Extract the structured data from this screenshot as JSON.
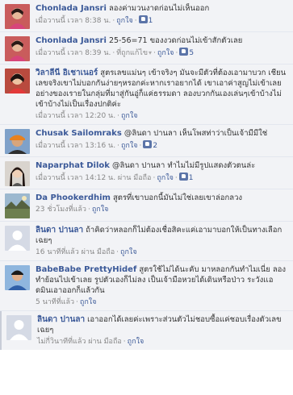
{
  "comments": [
    {
      "author": "Chonlada Jansri",
      "text": "ลองค่ามวนงาดก่อนไม่เห็นออก",
      "time": "เมื่อวานนี้ เวลา 8:38 น.",
      "like_label": "ถูกใจ",
      "likes": "1",
      "via": "",
      "avatar": "woman-pink-photo"
    },
    {
      "author": "Chonlada Jansri",
      "text": "25-56=71 ของงวดก่อนไม่เข้าสักตัวเลย",
      "time": "เมื่อวานนี้ เวลา 8:39 น.",
      "edited_label": "ที่ถูกแก้ไข",
      "like_label": "ถูกใจ",
      "likes": "5",
      "via": "",
      "avatar": "woman-pink-photo"
    },
    {
      "author": "วิลาลีนี อิเชาเนอร์",
      "text": "สูตรเลขแม่นๆ เข้าจริงๆ มันจะมีตัวที่ต้องเอามาบวก เชียนเลขจริงเขาไม่บอกกันง่ายๆหรอกค่ะหากเราอยากได้ เขาเอาค่าสูญไม่เข้าเลย อย่างของเรายในกลุ่มที่มาสู่กันอู่ก็แค่ธรรมดา ลองบวกกันเองเล่นๆเข้าบ้างไม่เข้าบ้างไม่เป็นเรื่องปกติค่ะ",
      "time": "เมื่อวานนี้ เวลา 12:20 น.",
      "like_label": "ถูกใจ",
      "likes": "",
      "via": "",
      "avatar": "woman-red-photo"
    },
    {
      "author": "Chusak Sailomraks",
      "text": "@ลินดา ปานลา เห็นโพสท่าว่าเป็นเจ้ามีมีใช่",
      "time": "เมื่อวานนี้ เวลา 13:16 น.",
      "like_label": "ถูกใจ",
      "likes": "2",
      "via": "",
      "avatar": "man-orange-cap-photo"
    },
    {
      "author": "Naparphat Dilok",
      "text": "@ลินดา ปานลา ทำไมไม่มีรูปแสดงตัวตนล่ะ",
      "time": "เมื่อวานนี้ เวลา 14:12 น. ผ่าน มือถือ",
      "like_label": "ถูกใจ",
      "likes": "1",
      "via": "",
      "avatar": "woman-dark-hair-photo"
    },
    {
      "author": "Da Phookerdhim",
      "text": "สูตรที่เขาบอกนี้มันไม่ใช่เลยเขาล่อกลวง",
      "time": "23 ชั่วโมงที่แล้ว",
      "like_label": "ถูกใจ",
      "likes": "",
      "via": "",
      "avatar": "landscape-photo"
    },
    {
      "author": "ลินดา ปานลา",
      "text": "ถ้าคิดว่าหลอกก็ไม่ต้องเชื่อสิคะแค่เอามาบอกให้เป็นทางเลือกเฉยๆ",
      "time": "16 นาทีที่แล้ว ผ่าน มือถือ",
      "like_label": "ถูกใจ",
      "likes": "",
      "via": "",
      "avatar": "default-silhouette"
    },
    {
      "author": "BabeBabe PrettyHidef",
      "text": "สูตรใช้ไม่ได้นะคับ มาหลอกกันทำไมเนี่ย ลองทำย้อนไปเข้าเลย รูปตัวเองก็ไม่ลง เป็นเจ้ามือหวยได้เดินหรือป่าว ระวังเเอดมินเอาออกก็แล้วกัน",
      "time": "5 นาทีที่แล้ว",
      "like_label": "ถูกใจ",
      "likes": "",
      "via": "",
      "avatar": "man-blue-photo"
    },
    {
      "author": "ลินดา ปานลา",
      "text": "เอาออกได้เลยค่ะเพราะส่วนตัวไม่ชอบซื้อแค่ชอบเรื่องตัวเลขเฉยๆ",
      "time": "ไม่กี่วินาทีที่แล้ว ผ่าน มือถือ",
      "like_label": "ถูกใจ",
      "likes": "",
      "via": "",
      "avatar": "default-silhouette"
    }
  ],
  "colors": {
    "link": "#3b5998",
    "meta": "#888888",
    "highlight_bg": "#f2f3f6"
  }
}
